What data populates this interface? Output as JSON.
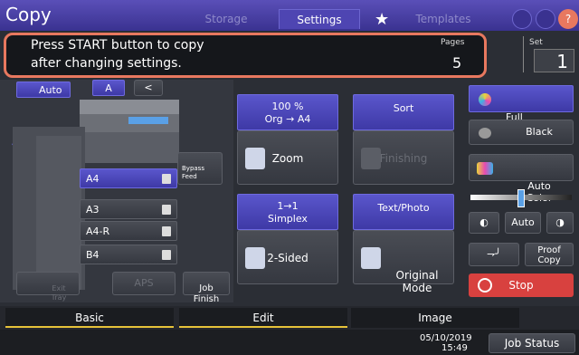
{
  "topbar": {
    "title": "Copy",
    "tabs": [
      {
        "label": "Storage"
      },
      {
        "label": "Settings"
      },
      {
        "label": "Templates"
      }
    ]
  },
  "message": {
    "line1": "Press START button to copy",
    "line2": "after changing settings.",
    "pages_label": "Pages",
    "pages_value": "5",
    "set_label": "Set",
    "set_value": "1"
  },
  "machine": {
    "auto_label": "Auto",
    "a_label": "A",
    "bypass_label": "Bypass\nFeed",
    "trays": [
      {
        "label": "A4"
      },
      {
        "label": "A3"
      },
      {
        "label": "A4-R"
      },
      {
        "label": "B4"
      }
    ],
    "exit_tray_label": "Exit\nTray",
    "aps_label": "APS",
    "job_finish_label": "Job\nFinish"
  },
  "features": {
    "zoom_hdr": "100 %\nOrg → A4",
    "zoom_btn": "Zoom",
    "sort_hdr": "Sort",
    "finishing_btn": "Finishing",
    "simplex_hdr": "1→1\nSimplex",
    "twosided_btn": "2-Sided",
    "mode_hdr": "Text/Photo",
    "original_mode_btn": "Original\nMode"
  },
  "right": {
    "full_color": "Full\nColor",
    "black": "Black",
    "auto_color": "Auto\nColor",
    "auto_density": "Auto",
    "proof_copy": "Proof\nCopy",
    "stop": "Stop"
  },
  "bottom": {
    "tabs": [
      {
        "label": "Basic"
      },
      {
        "label": "Edit"
      },
      {
        "label": "Image"
      }
    ],
    "date": "05/10/2019",
    "time": "15:49",
    "job_status": "Job Status"
  },
  "colors": {
    "accent": "#e8785f",
    "blue": "#4e45b2",
    "stop": "#d8413f",
    "selected_tab_underline": "#e6c23a"
  }
}
